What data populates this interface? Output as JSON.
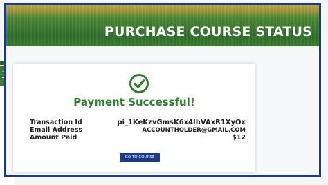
{
  "background_window": {
    "menu_icon": "menu-icon"
  },
  "banner": {
    "title": "PURCHASE COURSE STATUS"
  },
  "card": {
    "status_icon": "check-circle-icon",
    "message": "Payment Successful!",
    "rows": [
      {
        "label": "Transaction Id",
        "value": "pi_1KeKzvGmsK6x4IhVAxR1XyOx"
      },
      {
        "label": "Email Address",
        "value": "ACCOUNTHOLDER@GMAIL.COM"
      },
      {
        "label": "Amount Paid",
        "value": "$12"
      }
    ],
    "button_label": "GO TO COURSE"
  },
  "colors": {
    "frame_border": "#1f3a85",
    "success_green": "#2f7f2c",
    "button_bg": "#1f3a85"
  }
}
